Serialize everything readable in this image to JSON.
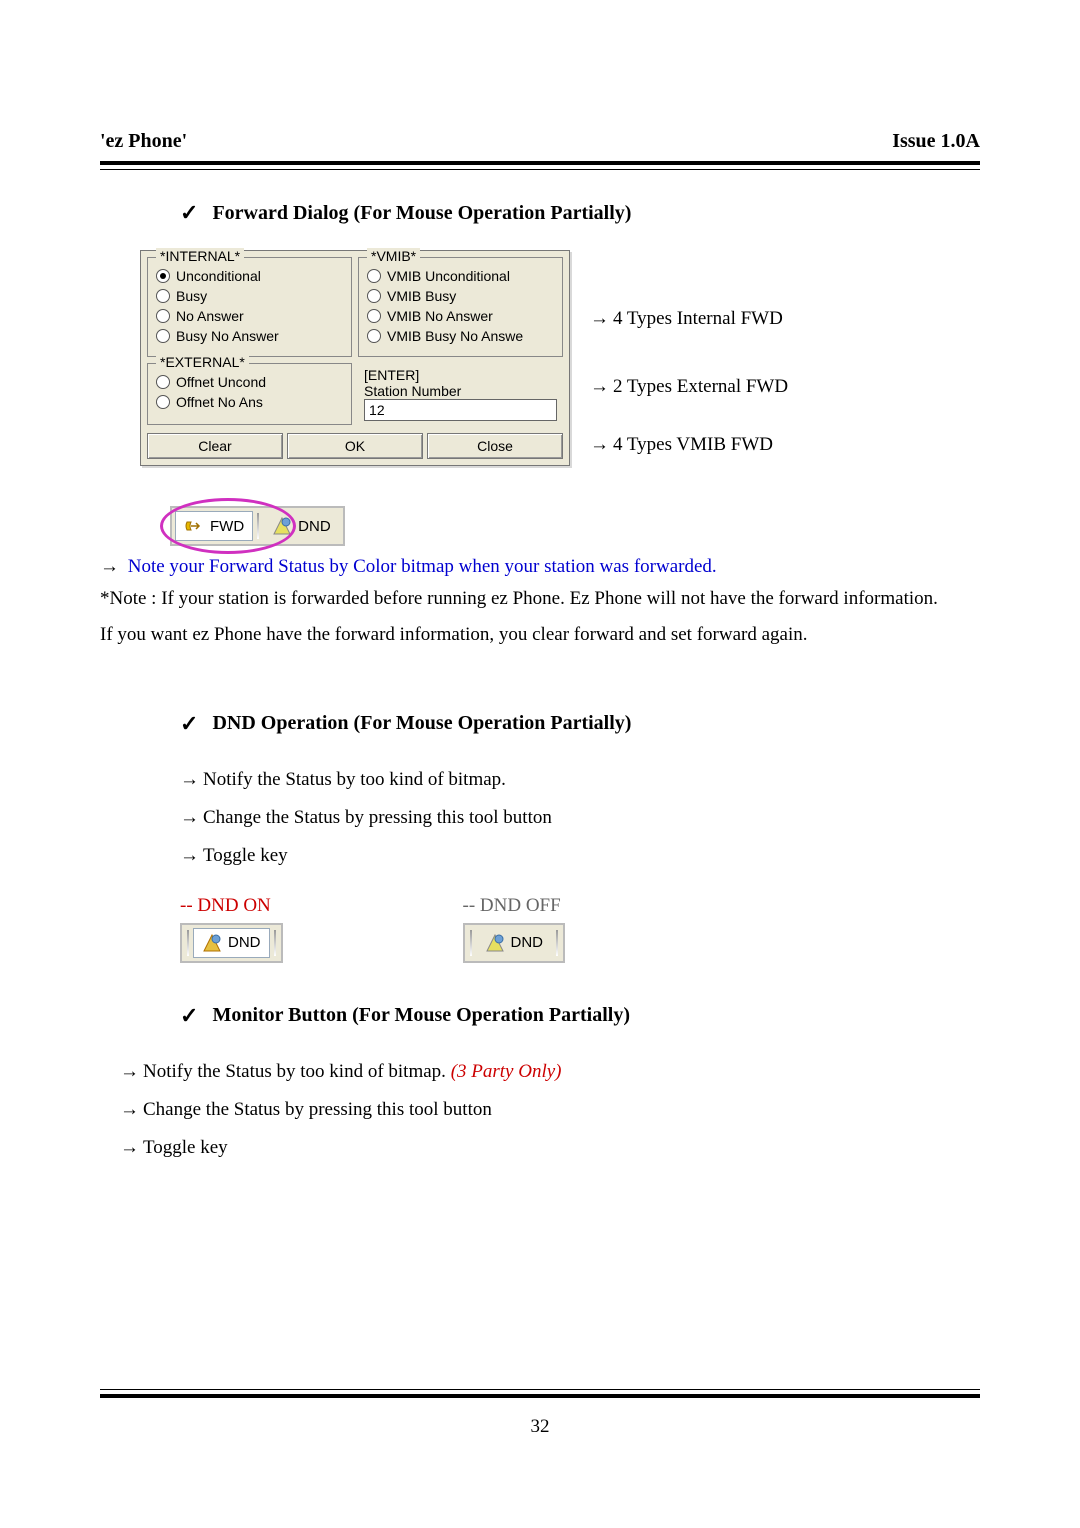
{
  "header": {
    "left": "'ez Phone'",
    "right": "Issue 1.0A"
  },
  "page_number": "32",
  "section1": {
    "title": "Forward Dialog (For Mouse Operation Partially)",
    "dialog": {
      "internal": {
        "legend": "*INTERNAL*",
        "opts": [
          "Unconditional",
          "Busy",
          "No Answer",
          "Busy No Answer"
        ],
        "selected": 0
      },
      "vmib": {
        "legend": "*VMIB*",
        "opts": [
          "VMIB Unconditional",
          "VMIB Busy",
          "VMIB No Answer",
          "VMIB Busy No Answe"
        ]
      },
      "external": {
        "legend": "*EXTERNAL*",
        "opts": [
          "Offnet Uncond",
          "Offnet No Ans"
        ]
      },
      "enter": {
        "label1": "[ENTER]",
        "label2": "Station Number",
        "value": "12"
      },
      "buttons": {
        "clear": "Clear",
        "ok": "OK",
        "close": "Close"
      }
    },
    "annotations": {
      "a1": "4 Types Internal FWD",
      "a2": "2 Types External FWD",
      "a3": "4 Types VMIB FWD"
    },
    "toolbar": {
      "fwd": "FWD",
      "dnd": "DND"
    },
    "note_blue": "Note your Forward Status by Color bitmap when your station was forwarded.",
    "note1": "*Note : If your station is forwarded before running ez Phone. Ez Phone will not have the forward information.",
    "note2": "If you want ez Phone have the forward information, you clear forward and set forward again."
  },
  "section2": {
    "title": "DND Operation (For Mouse Operation Partially)",
    "b1": "Notify the Status by too kind of bitmap.",
    "b2": "Change the Status by pressing this tool button",
    "b3": "Toggle key",
    "on_label": "-- DND ON",
    "off_label": "-- DND OFF",
    "dnd_text": "DND"
  },
  "section3": {
    "title": "Monitor Button (For Mouse Operation Partially)",
    "b1a": "Notify the Status by too kind of bitmap. ",
    "b1b": "(3 Party Only)",
    "b2": "Change the Status by pressing this tool button",
    "b3": "Toggle key"
  }
}
